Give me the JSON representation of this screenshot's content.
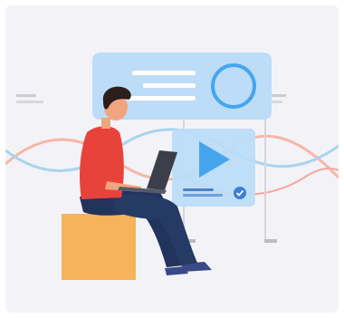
{
  "illustration": {
    "colors": {
      "background": "#f3f3f7",
      "panel": "#bcdcf7",
      "panel_accent": "#45a6ee",
      "wave_warm": "#f4b8a8",
      "wave_cool": "#a9d4ef",
      "shirt": "#e8433a",
      "pants": "#22335c",
      "skin": "#f0a57e",
      "hair": "#2b1e1c",
      "box": "#f7b35b",
      "laptop": "#3b3f4a",
      "shoes": "#3a4a86"
    },
    "icons": [
      "circle-icon",
      "play-icon",
      "check-icon",
      "laptop-icon"
    ]
  }
}
